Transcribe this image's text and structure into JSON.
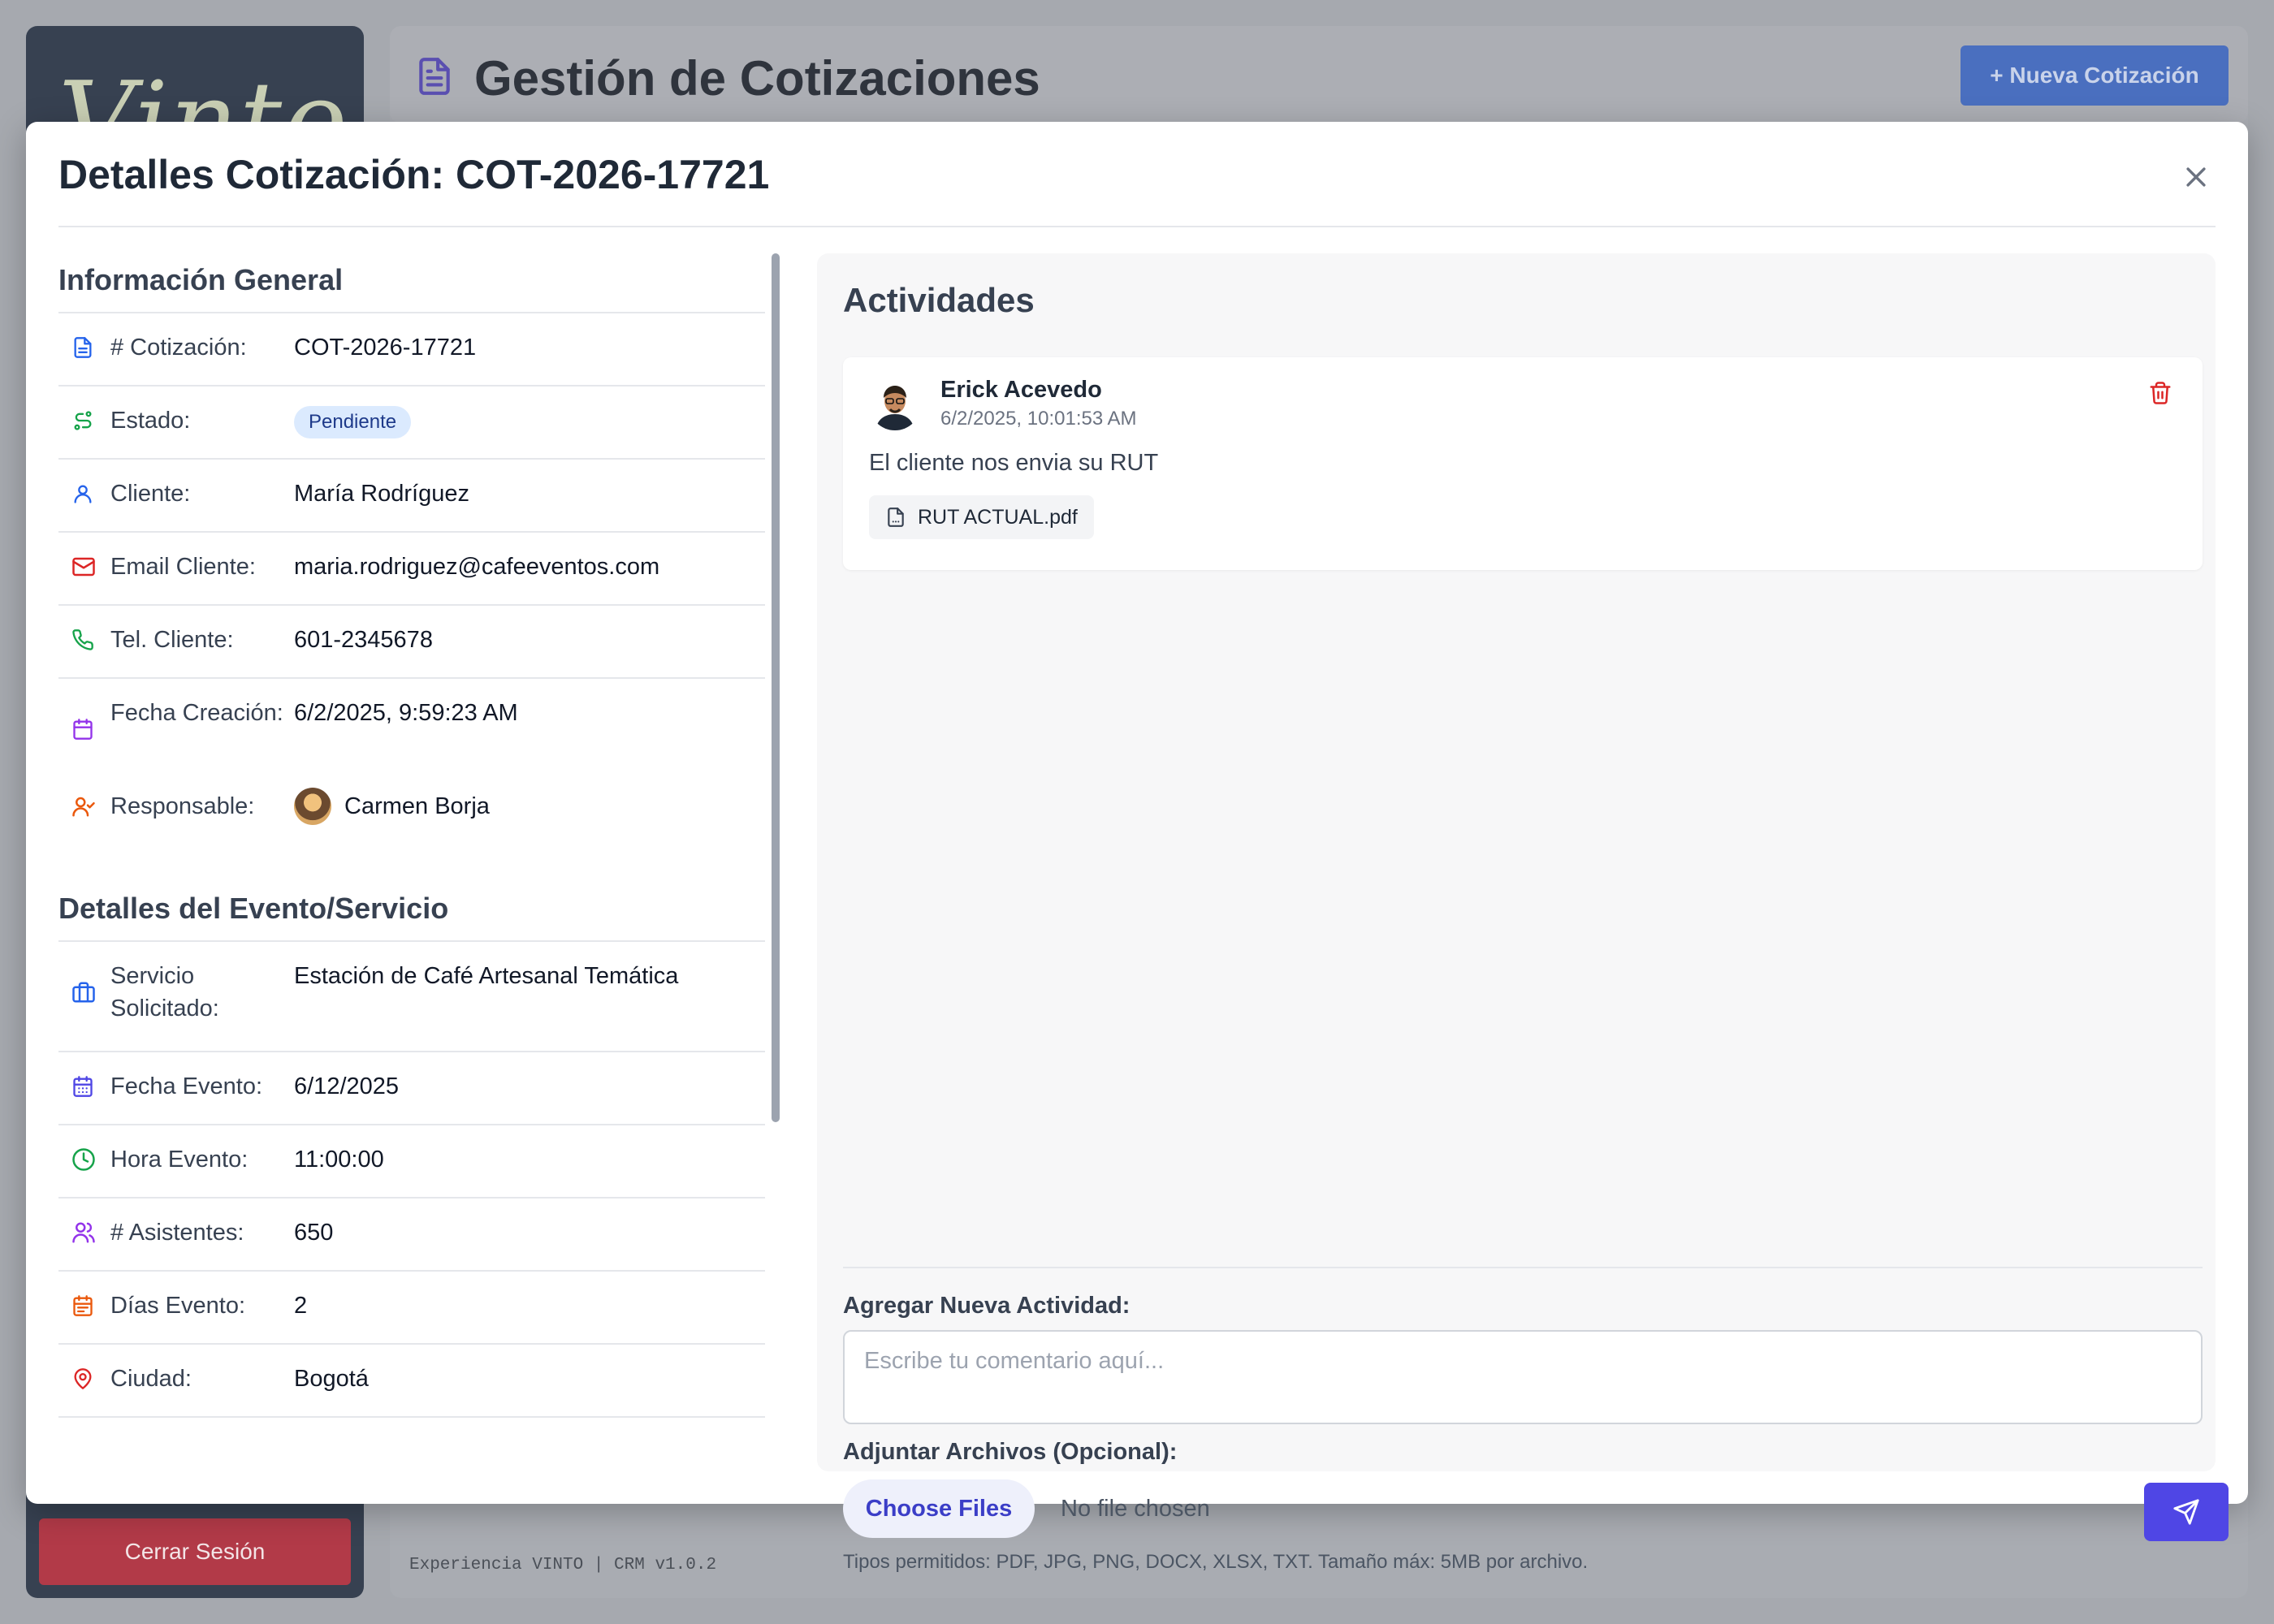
{
  "app": {
    "logo_text": "Vinto",
    "page_title": "Gestión de Cotizaciones",
    "new_quote_button": "+ Nueva Cotización",
    "logout_button": "Cerrar Sesión",
    "footer": "Experiencia VINTO | CRM v1.0.2"
  },
  "modal": {
    "title": "Detalles Cotización: COT-2026-17721",
    "general_section": "Información General",
    "general_rows": [
      {
        "label": "# Cotización:",
        "value": "COT-2026-17721",
        "icon": "document-icon"
      },
      {
        "label": "Estado:",
        "value": "Pendiente",
        "icon": "status-icon"
      },
      {
        "label": "Cliente:",
        "value": "María Rodríguez",
        "icon": "user-icon"
      },
      {
        "label": "Email Cliente:",
        "value": "maria.rodriguez@cafeeventos.com",
        "icon": "mail-icon"
      },
      {
        "label": "Tel. Cliente:",
        "value": "601-2345678",
        "icon": "phone-icon"
      },
      {
        "label": "Fecha Creación:",
        "value": "6/2/2025, 9:59:23 AM",
        "icon": "calendar-icon"
      },
      {
        "label": "Responsable:",
        "value": "Carmen Borja",
        "icon": "user-check-icon"
      }
    ],
    "event_section": "Detalles del Evento/Servicio",
    "event_rows": [
      {
        "label": "Servicio Solicitado:",
        "value": "Estación de Café Artesanal Temática",
        "icon": "briefcase-icon"
      },
      {
        "label": "Fecha Evento:",
        "value": "6/12/2025",
        "icon": "calendar-days-icon"
      },
      {
        "label": "Hora Evento:",
        "value": "11:00:00",
        "icon": "clock-icon"
      },
      {
        "label": "# Asistentes:",
        "value": "650",
        "icon": "users-icon"
      },
      {
        "label": "Días Evento:",
        "value": "2",
        "icon": "calendar-range-icon"
      },
      {
        "label": "Ciudad:",
        "value": "Bogotá",
        "icon": "map-pin-icon"
      }
    ]
  },
  "activities": {
    "title": "Actividades",
    "items": [
      {
        "author": "Erick Acevedo",
        "timestamp": "6/2/2025, 10:01:53 AM",
        "text": "El cliente nos envia su RUT",
        "attachment": "RUT ACTUAL.pdf"
      }
    ],
    "add_label": "Agregar Nueva Actividad:",
    "comment_placeholder": "Escribe tu comentario aquí...",
    "attach_label": "Adjuntar Archivos (Opcional):",
    "choose_files": "Choose Files",
    "no_file": "No file chosen",
    "hint": "Tipos permitidos: PDF, JPG, PNG, DOCX, XLSX, TXT. Tamaño máx: 5MB por archivo."
  },
  "colors": {
    "accent": "#4f46e5",
    "badge_bg": "#dbeafe",
    "danger": "#dc2626"
  }
}
